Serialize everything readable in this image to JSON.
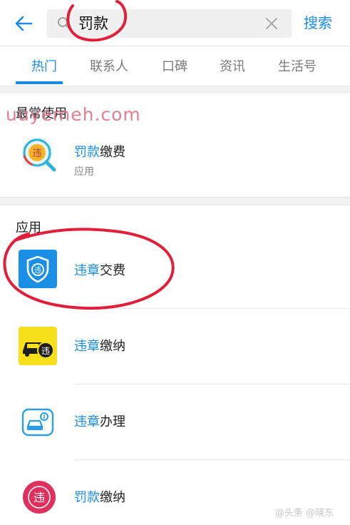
{
  "topbar": {
    "search_value": "罚款",
    "search_button": "搜索"
  },
  "tabs": [
    {
      "label": "热门",
      "active": true
    },
    {
      "label": "联系人",
      "active": false
    },
    {
      "label": "口碑",
      "active": false
    },
    {
      "label": "资讯",
      "active": false
    },
    {
      "label": "生活号",
      "active": false
    }
  ],
  "watermark": "uuyemeh.com",
  "recent": {
    "title": "最常使用",
    "items": [
      {
        "highlight": "罚款",
        "rest": "缴费",
        "subtitle": "应用",
        "icon": "fine-payment-icon"
      }
    ]
  },
  "apps": {
    "title": "应用",
    "items": [
      {
        "highlight": "违章",
        "rest": "交费",
        "icon": "shield-violation-icon"
      },
      {
        "highlight": "违章",
        "rest": "缴纳",
        "icon": "car-violation-icon"
      },
      {
        "highlight": "违章",
        "rest": "办理",
        "icon": "car-settlement-icon"
      },
      {
        "highlight": "罚款",
        "rest": "缴纳",
        "icon": "red-violation-icon"
      }
    ]
  },
  "corner_mark": "@头条 @晓东",
  "colors": {
    "accent": "#1a8ce8",
    "annotation": "#e0203a",
    "watermark": "#e07a8c"
  }
}
